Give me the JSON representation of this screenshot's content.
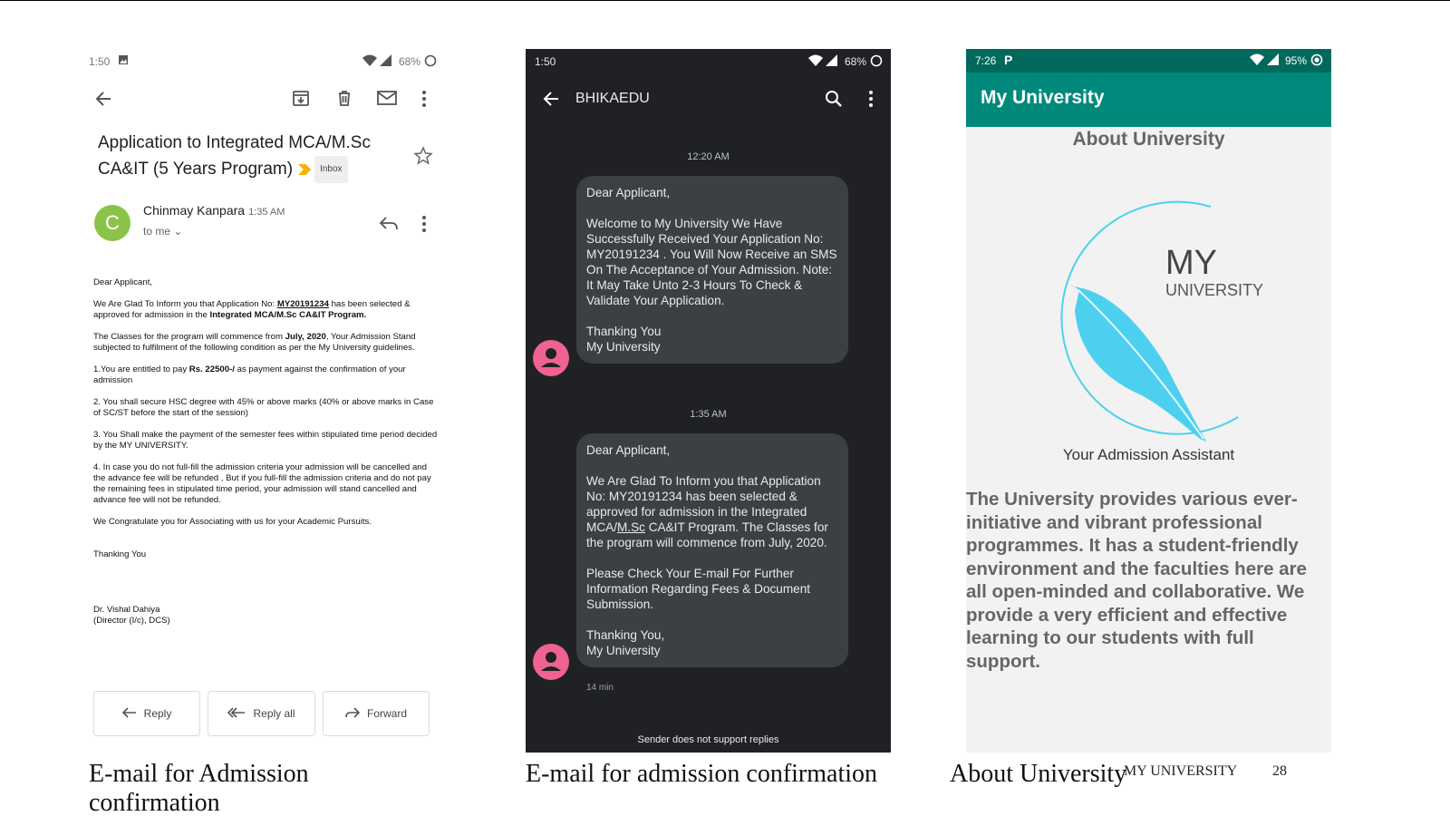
{
  "gmail": {
    "status_time": "1:50",
    "battery": "68%",
    "subject": "Application to Integrated MCA/M.Sc CA&IT (5 Years Program)",
    "label": "Inbox",
    "avatar_letter": "C",
    "sender": "Chinmay Kanpara",
    "time": "1:35 AM",
    "to": "to me",
    "body": {
      "greeting": "Dear Applicant,",
      "p1_a": "We Are Glad To Inform you that Application No: ",
      "p1_app_no": "MY20191234",
      "p1_b": " has been selected & approved for admission in the ",
      "p1_program": "Integrated MCA/M.Sc CA&IT Program.",
      "p2_a": "The Classes for the program will commence from ",
      "p2_date": "July, 2020",
      "p2_b": ", Your Admission Stand subjected to fulfilment of the following condition as per the My University guidelines.",
      "c1_a": "1.You are entitled to pay ",
      "c1_amount": "Rs. 22500-/",
      "c1_b": " as payment against the confirmation of your admission",
      "c2": "2. You shall secure HSC degree with 45% or above marks (40% or above marks in Case of SC/ST before the start of the session)",
      "c3": "3. You Shall make the payment of the semester fees within stipulated time period decided by the MY UNIVERSITY.",
      "c4": "4. In case you do not full-fill the admission criteria your admission will be cancelled and the advance fee will be refunded , But if you full-fill the admission criteria and do not pay the remaining fees in stipulated time period, your admission will stand cancelled and advance fee will not be refunded.",
      "congrats": "We Congratulate you for Associating with us for your Academic Pursuits.",
      "thanks": "Thanking You",
      "signer": "Dr. Vishal Dahiya",
      "signer_title": "(Director (I/c), DCS)"
    },
    "buttons": {
      "reply": "Reply",
      "reply_all": "Reply all",
      "forward": "Forward"
    }
  },
  "sms": {
    "status_time": "1:50",
    "battery": "68%",
    "sender": "BHIKAEDU",
    "msg1": {
      "time": "12:20 AM",
      "greeting": "Dear Applicant,",
      "body": "Welcome to My University We Have Successfully Received Your Application No: MY20191234 . You Will Now Receive an SMS On The Acceptance of Your Admission. Note: It May Take Unto 2-3 Hours To Check & Validate Your Application.",
      "sign1": "Thanking You",
      "sign2": "My University"
    },
    "msg2": {
      "time": "1:35 AM",
      "greeting": "Dear Applicant,",
      "body_a": "We Are Glad To Inform you that Application No: MY20191234 has been selected & approved for admission in the Integrated MCA/",
      "body_link": "M.Sc",
      "body_b": " CA&IT Program. The Classes for the program will commence from July, 2020.",
      "body2": "Please Check Your E-mail For Further Information Regarding Fees & Document Submission.",
      "sign1": "Thanking You,",
      "sign2": "My University",
      "age": "14 min"
    },
    "footer": "Sender does not support replies"
  },
  "app": {
    "status_time": "7:26",
    "battery": "95%",
    "title": "My University",
    "heading": "About University",
    "logo_my": "MY",
    "logo_university": "UNIVERSITY",
    "tagline": "Your Admission Assistant",
    "description": "The University provides various ever-initiative and vibrant professional programmes. It has a student-friendly environment and the faculties here are all open-minded and collaborative. We provide a very efficient and effective learning to our students with full support."
  },
  "captions": {
    "c1_line1": "E-mail for Admission",
    "c1_line2": "confirmation",
    "c2": "E-mail for admission confirmation",
    "c3": "About University"
  },
  "footer": {
    "org": "MY UNIVERSITY",
    "page": "28"
  },
  "colors": {
    "gmail_avatar": "#8bc34a",
    "sms_avatar": "#f06292",
    "app_bar": "#00897b",
    "feather": "#4dd0f0"
  }
}
